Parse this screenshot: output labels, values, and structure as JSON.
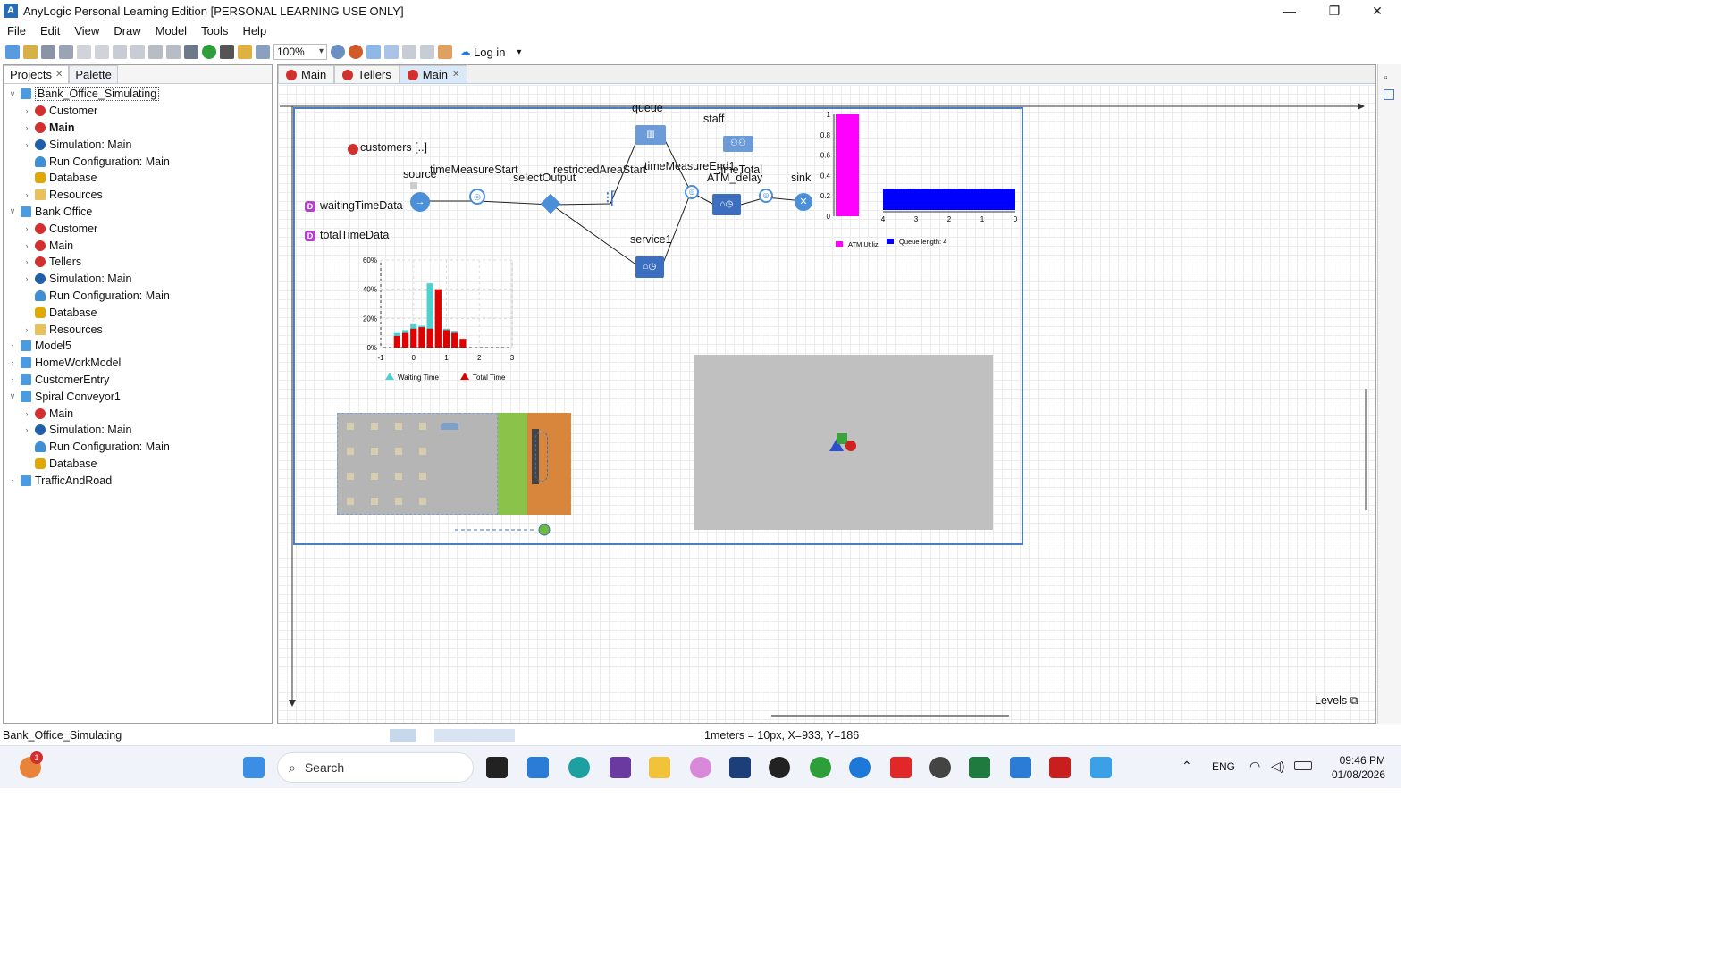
{
  "window": {
    "title": "AnyLogic Personal Learning Edition [PERSONAL LEARNING USE ONLY]",
    "controls": [
      "—",
      "❐",
      "✕"
    ]
  },
  "menu": [
    "File",
    "Edit",
    "View",
    "Draw",
    "Model",
    "Tools",
    "Help"
  ],
  "toolbar": {
    "zoom": "100%",
    "login": "Log in"
  },
  "projects_panel": {
    "tabs": [
      "Projects",
      "Palette"
    ],
    "tree": [
      {
        "label": "Bank_Office_Simulating",
        "icon": "proj",
        "level": 0,
        "expand": "v",
        "selected": true
      },
      {
        "label": "Customer",
        "icon": "agent",
        "level": 1,
        "expand": ">"
      },
      {
        "label": "Main",
        "icon": "agent",
        "level": 1,
        "expand": ">",
        "bold": true
      },
      {
        "label": "Simulation: Main",
        "icon": "sim",
        "level": 1,
        "expand": ">"
      },
      {
        "label": "Run Configuration: Main",
        "icon": "run",
        "level": 1,
        "expand": ""
      },
      {
        "label": "Database",
        "icon": "db",
        "level": 1,
        "expand": ""
      },
      {
        "label": "Resources",
        "icon": "folder",
        "level": 1,
        "expand": ">"
      },
      {
        "label": "Bank Office",
        "icon": "proj",
        "level": 0,
        "expand": "v"
      },
      {
        "label": "Customer",
        "icon": "agent",
        "level": 1,
        "expand": ">"
      },
      {
        "label": "Main",
        "icon": "agent",
        "level": 1,
        "expand": ">"
      },
      {
        "label": "Tellers",
        "icon": "agent",
        "level": 1,
        "expand": ">"
      },
      {
        "label": "Simulation: Main",
        "icon": "sim",
        "level": 1,
        "expand": ">"
      },
      {
        "label": "Run Configuration: Main",
        "icon": "run",
        "level": 1,
        "expand": ""
      },
      {
        "label": "Database",
        "icon": "db",
        "level": 1,
        "expand": ""
      },
      {
        "label": "Resources",
        "icon": "folder",
        "level": 1,
        "expand": ">"
      },
      {
        "label": "Model5",
        "icon": "proj",
        "level": 0,
        "expand": ">"
      },
      {
        "label": "HomeWorkModel",
        "icon": "proj",
        "level": 0,
        "expand": ">"
      },
      {
        "label": "CustomerEntry",
        "icon": "proj",
        "level": 0,
        "expand": ">"
      },
      {
        "label": "Spiral Conveyor1",
        "icon": "proj",
        "level": 0,
        "expand": "v"
      },
      {
        "label": "Main",
        "icon": "agent",
        "level": 1,
        "expand": ">"
      },
      {
        "label": "Simulation: Main",
        "icon": "sim",
        "level": 1,
        "expand": ">"
      },
      {
        "label": "Run Configuration: Main",
        "icon": "run",
        "level": 1,
        "expand": ""
      },
      {
        "label": "Database",
        "icon": "db",
        "level": 1,
        "expand": ""
      },
      {
        "label": "TrafficAndRoad",
        "icon": "proj",
        "level": 0,
        "expand": ">"
      }
    ]
  },
  "editor": {
    "tabs": [
      {
        "label": "Main",
        "active": false,
        "closable": false
      },
      {
        "label": "Tellers",
        "active": false,
        "closable": false
      },
      {
        "label": "Main",
        "active": true,
        "closable": true
      }
    ],
    "diagram_labels": {
      "customers": "customers [..]",
      "source": "source",
      "timeMeasureStart": "timeMeasureStart",
      "selectOutput": "selectOutput",
      "restrictedAreaStart": "restrictedAreaStart",
      "queue": "queue",
      "staff": "staff",
      "timeMeasureEnd1": "timeMeasureEnd1",
      "timeTotal": "timeTotal",
      "ATM_delay": "ATM_delay",
      "sink": "sink",
      "service1": "service1",
      "waitingTimeData": "waitingTimeData",
      "totalTimeData": "totalTimeData"
    },
    "levels_label": "Levels"
  },
  "colors": {
    "flow_blue": "#3c6fbf",
    "magenta": "#ff00ff",
    "blue_bar": "#0000ff",
    "cyan": "#4dd0d0",
    "red": "#e00000",
    "green_block": "#8bc34a",
    "orange_block": "#d9863d",
    "gray_area": "#c0c0c0"
  },
  "chart_data": [
    {
      "type": "bar",
      "categories": [
        "ATM Utiliz"
      ],
      "values": [
        1.0
      ],
      "ylim": [
        0,
        1
      ],
      "yticks": [
        "0",
        "0.2",
        "0.4",
        "0.6",
        "0.8",
        "1"
      ],
      "legend": [
        "ATM Utiliz"
      ]
    },
    {
      "type": "bar",
      "orientation": "horizontal",
      "categories": [
        "Queue length"
      ],
      "values": [
        4
      ],
      "xlim": [
        4,
        0
      ],
      "xticks": [
        "4",
        "3",
        "2",
        "1",
        "0"
      ],
      "legend": [
        "Queue length: 4"
      ]
    },
    {
      "type": "bar",
      "xticks": [
        "-1",
        "0",
        "1",
        "2",
        "3"
      ],
      "yticks": [
        "0%",
        "20%",
        "40%",
        "60%"
      ],
      "ylim": [
        0,
        60
      ],
      "series": [
        {
          "name": "Waiting Time",
          "x": [
            -0.5,
            -0.25,
            0.0,
            0.25,
            0.5,
            0.75,
            1.0,
            1.25,
            1.5,
            1.75
          ],
          "values": [
            10,
            12,
            16,
            15,
            44,
            38,
            13,
            11,
            6,
            0
          ]
        },
        {
          "name": "Total Time",
          "x": [
            -0.5,
            -0.25,
            0.0,
            0.25,
            0.5,
            0.75,
            1.0,
            1.25,
            1.5,
            1.75
          ],
          "values": [
            8,
            10,
            13,
            14,
            13,
            40,
            12,
            10,
            6,
            0
          ]
        }
      ],
      "legend": [
        "Waiting Time",
        "Total Time"
      ]
    }
  ],
  "statusbar": {
    "left": "Bank_Office_Simulating",
    "scale": "1meters = 10px, X=933, Y=186"
  },
  "taskbar": {
    "search": "Search",
    "lang": "ENG",
    "time": "09:46 PM",
    "date": "01/08/2026",
    "badge": "1"
  }
}
